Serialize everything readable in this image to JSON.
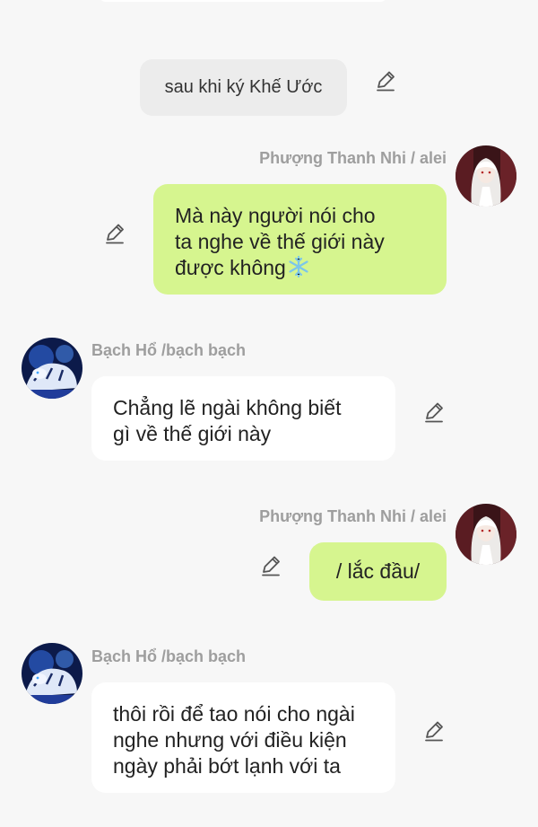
{
  "system_message": {
    "text": "sau khi ký Khế Ước"
  },
  "messages": [
    {
      "side": "right",
      "name": "Phượng Thanh Nhi / alei",
      "lines": [
        "Mà này người nói cho",
        "ta nghe về thế giới này",
        "được không"
      ],
      "trailing_icon": "snowflake-emoji"
    },
    {
      "side": "left",
      "name": "Bạch Hổ /bạch bạch",
      "lines": [
        "Chẳng lẽ ngài không biết",
        "gì về thế giới này"
      ]
    },
    {
      "side": "right",
      "name": "Phượng Thanh Nhi / alei",
      "lines": [
        "/ lắc đầu/"
      ]
    },
    {
      "side": "left",
      "name": "Bạch Hổ /bạch bạch",
      "lines": [
        "thôi rồi để tao nói cho ngài",
        "nghe nhưng với điều kiện",
        "ngày phải bớt lạnh với ta"
      ]
    }
  ],
  "icons": {
    "edit": "pencil-icon",
    "avatar_right": "white-haired-girl-avatar",
    "avatar_left": "white-tiger-avatar"
  },
  "colors": {
    "background": "#f7f7f7",
    "my_bubble": "#d6f58f",
    "other_bubble": "#ffffff",
    "system_bubble": "#ececec",
    "name_text": "#9e9e9e"
  }
}
